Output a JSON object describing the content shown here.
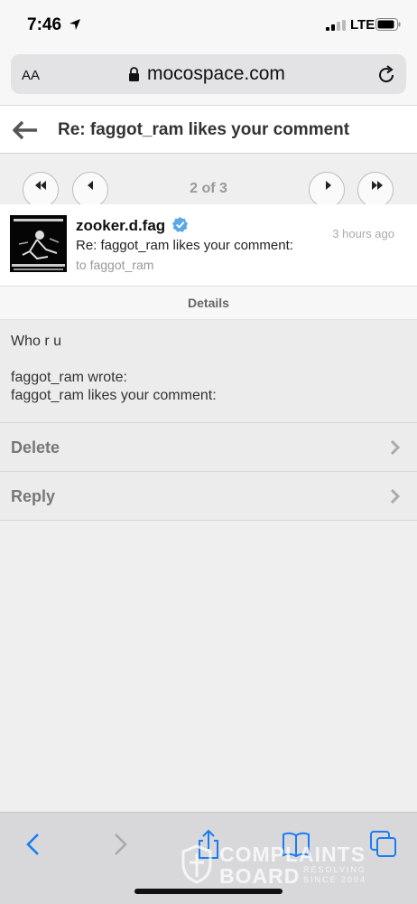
{
  "status_bar": {
    "time": "7:46",
    "network": "LTE",
    "icons": [
      "location-arrow-icon",
      "signal-icon",
      "battery-icon"
    ]
  },
  "browser": {
    "text_size_label": "AA",
    "domain": "mocospace.com",
    "icons": [
      "lock-icon",
      "reload-icon"
    ]
  },
  "header": {
    "title": "Re: faggot_ram likes your comment",
    "back_icon": "back-arrow-icon"
  },
  "pager": {
    "label": "2 of 3",
    "buttons": [
      "first-page-icon",
      "previous-page-icon",
      "next-page-icon",
      "last-page-icon"
    ]
  },
  "message": {
    "sender": "zooker.d.fag",
    "subject": "Re: faggot_ram likes your comment:",
    "recipient": "to faggot_ram",
    "time_ago": "3 hours ago",
    "details_label": "Details",
    "body_line1": "Who r u",
    "body_line2": "faggot_ram wrote:",
    "body_line3": "faggot_ram likes your comment:"
  },
  "actions": {
    "delete": "Delete",
    "reply": "Reply"
  },
  "toolbar": {
    "icons": [
      "back-icon",
      "forward-icon",
      "share-icon",
      "bookmarks-icon",
      "tabs-icon"
    ]
  },
  "watermark": {
    "line1": "COMPLAINTS",
    "line2": "BOARD",
    "tag1": "RESOLVING",
    "tag2": "SINCE 2004"
  },
  "colors": {
    "accent_blue": "#1a7cf5",
    "verified_blue": "#5aa8e6",
    "text_gray": "#777777"
  }
}
